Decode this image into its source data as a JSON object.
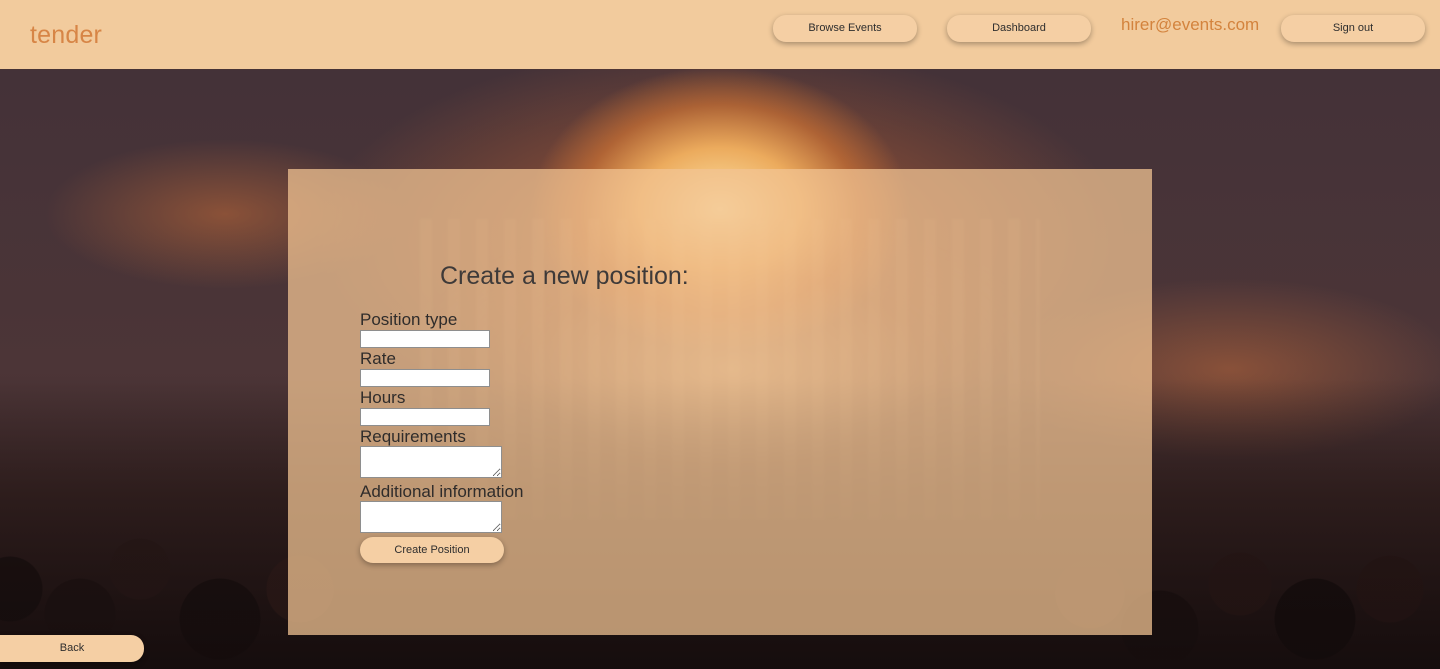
{
  "brand": {
    "name": "tender"
  },
  "nav": {
    "browse_label": "Browse Events",
    "dashboard_label": "Dashboard",
    "email": "hirer@events.com",
    "signout_label": "Sign out"
  },
  "form": {
    "title": "Create a new position:",
    "fields": {
      "position_type": {
        "label": "Position type",
        "value": ""
      },
      "rate": {
        "label": "Rate",
        "value": ""
      },
      "hours": {
        "label": "Hours",
        "value": ""
      },
      "requirements": {
        "label": "Requirements",
        "value": ""
      },
      "additional_information": {
        "label": "Additional information",
        "value": ""
      }
    },
    "submit_label": "Create Position"
  },
  "footer": {
    "back_label": "Back"
  },
  "colors": {
    "topbar": "#f2cb9d",
    "brand": "#d78546",
    "button": "#f5cfa4",
    "panel": "#f2c493"
  },
  "icons": {}
}
